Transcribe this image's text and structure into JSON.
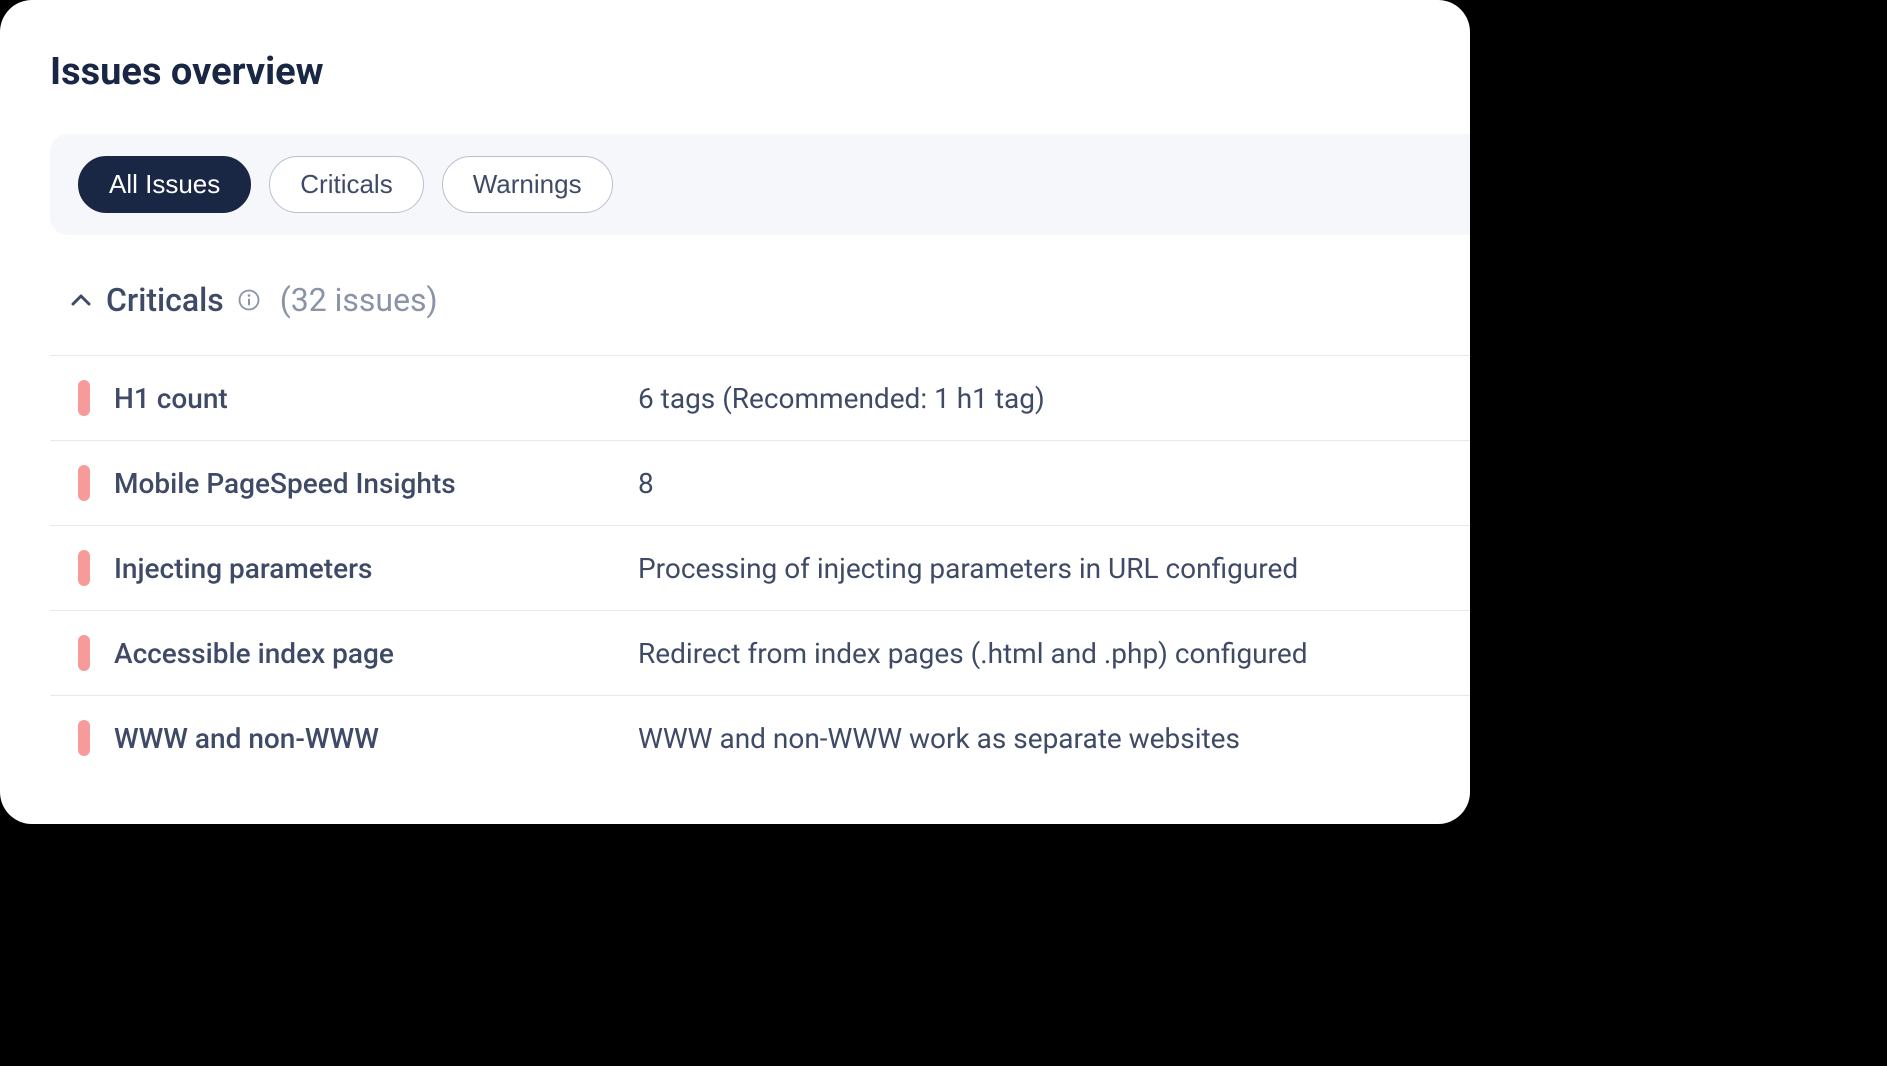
{
  "title": "Issues overview",
  "filters": {
    "all": "All Issues",
    "criticals": "Criticals",
    "warnings": "Warnings"
  },
  "section": {
    "title": "Criticals",
    "count_label": "(32 issues)"
  },
  "issues": [
    {
      "name": "H1 count",
      "value": "6 tags (Recommended: 1 h1 tag)"
    },
    {
      "name": "Mobile PageSpeed Insights",
      "value": "8"
    },
    {
      "name": "Injecting parameters",
      "value": "Processing of injecting parameters in URL configured"
    },
    {
      "name": "Accessible index page",
      "value": "Redirect from index pages (.html and .php) configured"
    },
    {
      "name": "WWW and non-WWW",
      "value": "WWW and non-WWW work as separate websites"
    }
  ]
}
